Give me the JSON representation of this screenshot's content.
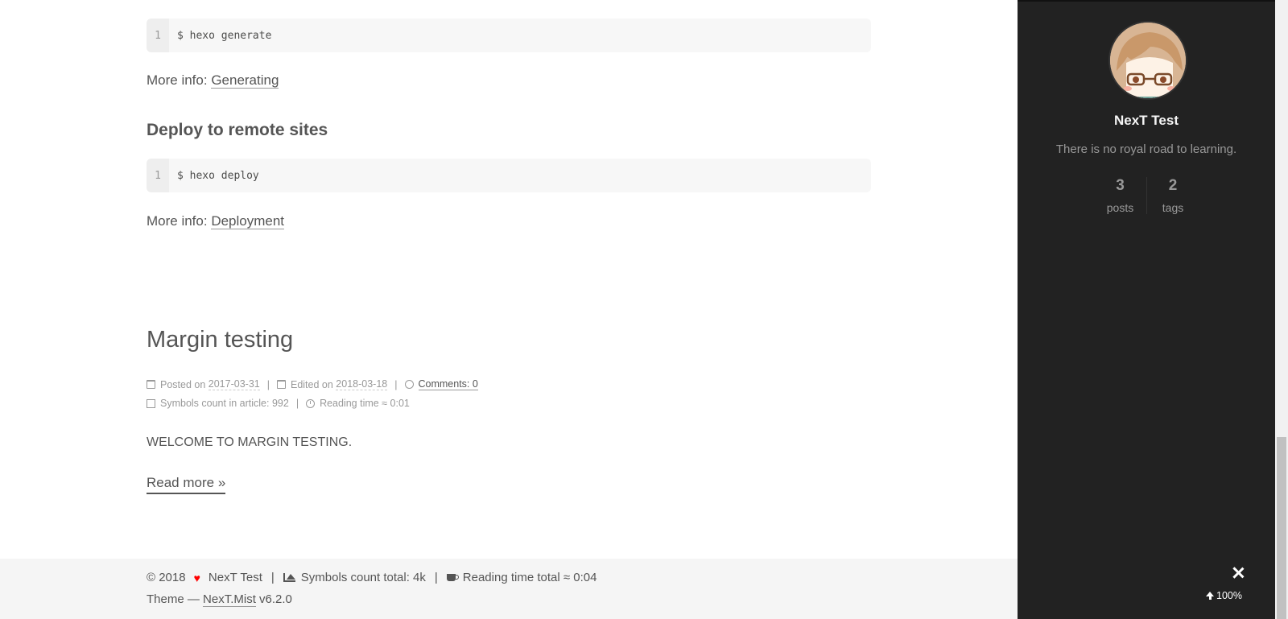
{
  "main": {
    "code1": {
      "line": "1",
      "text": "$ hexo generate"
    },
    "more_info_1": {
      "prefix": "More info: ",
      "link": "Generating"
    },
    "heading_deploy": "Deploy to remote sites",
    "code2": {
      "line": "1",
      "text": "$ hexo deploy"
    },
    "more_info_2": {
      "prefix": "More info: ",
      "link": "Deployment"
    }
  },
  "post": {
    "title": "Margin testing",
    "posted_label": "Posted on",
    "posted_date": "2017-03-31",
    "edited_label": "Edited on",
    "edited_date": "2018-03-18",
    "comments": "Comments: 0",
    "symbols": "Symbols count in article: 992",
    "reading": "Reading time ≈ 0:01",
    "separator": "|",
    "excerpt": "WELCOME TO MARGIN TESTING.",
    "read_more": "Read more »"
  },
  "footer": {
    "copyright": "© 2018",
    "author": "NexT Test",
    "symbols_total": "Symbols count total: 4k",
    "reading_total": "Reading time total ≈ 0:04",
    "theme_prefix": "Theme — ",
    "theme_link": "NexT.Mist",
    "theme_version": " v6.2.0",
    "separator": "|"
  },
  "sidebar": {
    "author": "NexT Test",
    "description": "There is no royal road to learning.",
    "posts_count": "3",
    "posts_label": "posts",
    "tags_count": "2",
    "tags_label": "tags",
    "back_to_top": "100%"
  },
  "colors": {
    "sidebar_bg": "#222222",
    "footer_bg": "#f5f5f5",
    "heart": "#ff0000"
  }
}
